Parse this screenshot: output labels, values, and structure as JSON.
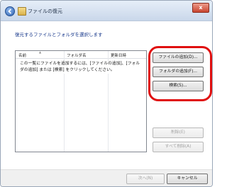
{
  "window": {
    "title": "ファイルの復元",
    "close_glyph": "x"
  },
  "instruction": "復元するファイルとフォルダを選択します",
  "list": {
    "columns": [
      "名前",
      "フォルダ名",
      "更新日時"
    ],
    "empty_message": "この一覧にファイルを追加するには、[ファイルの追加]、[フォルダの追加] または [検索] をクリックしてください。"
  },
  "side_buttons": {
    "add_files": "ファイルの追加(D)...",
    "add_folders": "フォルダの追加(F)...",
    "search": "検索(S)...",
    "remove": "削除(E)",
    "remove_all": "すべて削除(A)"
  },
  "footer": {
    "next": "次へ(N)",
    "cancel": "キャンセル"
  },
  "colors": {
    "highlight": "#e01010",
    "instruction_text": "#1a3a8c"
  },
  "icons": [
    "back-arrow-icon",
    "restore-files-icon",
    "sort-arrow-icon"
  ]
}
